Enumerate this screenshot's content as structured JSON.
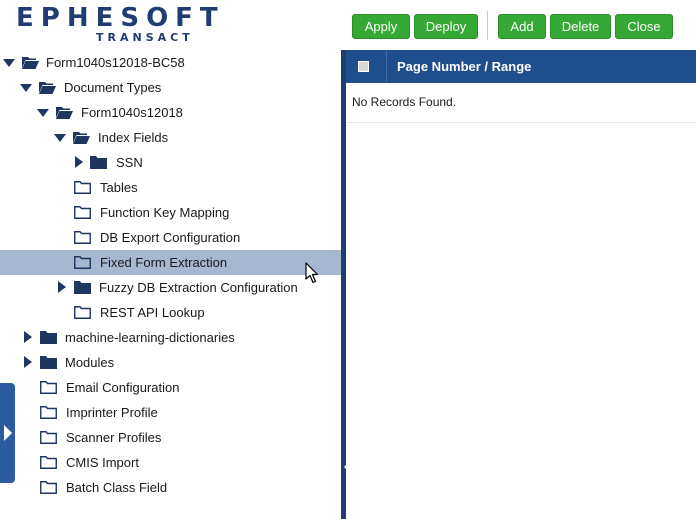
{
  "logo": {
    "main": "EPHESOFT",
    "sub": "TRANSACT"
  },
  "toolbar": {
    "apply": "Apply",
    "deploy": "Deploy",
    "add": "Add",
    "delete": "Delete",
    "close": "Close"
  },
  "tree": {
    "root": "Form1040s12018-BC58",
    "document_types": "Document Types",
    "form": "Form1040s12018",
    "index_fields": "Index Fields",
    "ssn": "SSN",
    "tables": "Tables",
    "function_key_mapping": "Function Key Mapping",
    "db_export": "DB Export Configuration",
    "fixed_form": "Fixed Form Extraction",
    "fuzzy_db": "Fuzzy DB Extraction Configuration",
    "rest_api": "REST API Lookup",
    "ml_dictionaries": "machine-learning-dictionaries",
    "modules": "Modules",
    "email_config": "Email Configuration",
    "imprinter": "Imprinter Profile",
    "scanner": "Scanner Profiles",
    "cmis": "CMIS Import",
    "batch_class_field": "Batch Class Field"
  },
  "grid": {
    "column_page": "Page Number / Range",
    "empty_message": "No Records Found."
  },
  "colors": {
    "brand_navy": "#1f3c73",
    "button_green": "#36a836",
    "grid_header": "#1f4e8c",
    "selection": "#a7b7cf"
  }
}
